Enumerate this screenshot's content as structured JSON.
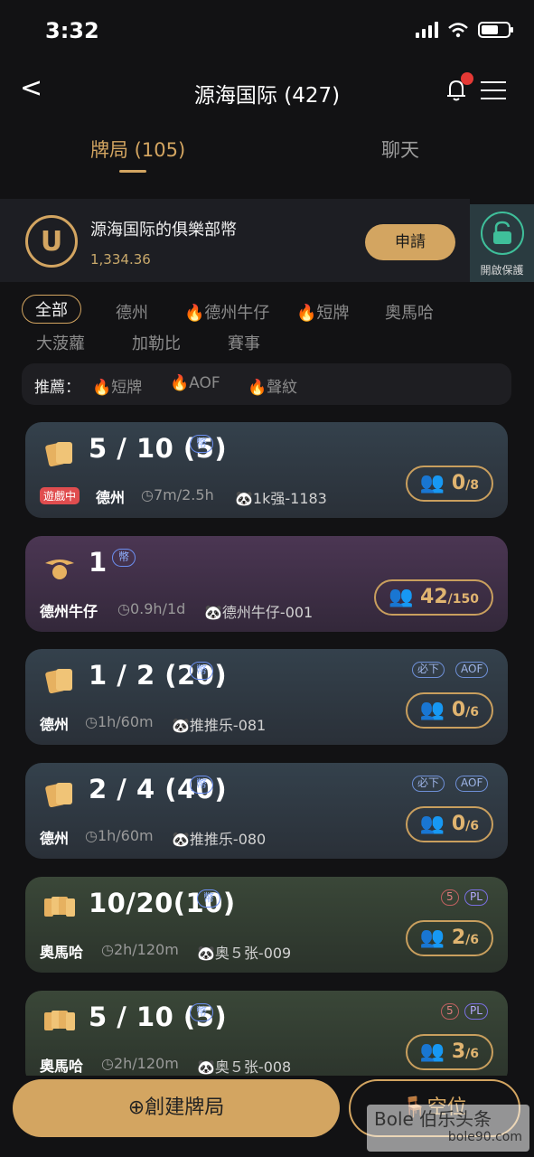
{
  "status": {
    "time": "3:32"
  },
  "nav": {
    "back": "<",
    "title": "源海国际 (427)"
  },
  "tabs": {
    "active": "牌局 (105)",
    "inactive": "聊天"
  },
  "club": {
    "name": "源海国际的俱樂部幣",
    "balance": "1,334.36",
    "apply": "申請",
    "unlock_label": "開啟保護",
    "coin_letter": "U"
  },
  "filters": {
    "all": "全部",
    "f1": "德州",
    "f2": "德州牛仔",
    "f3": "短牌",
    "f4": "奧馬哈",
    "f5": "大菠蘿",
    "f6": "加勒比",
    "f7": "賽事"
  },
  "recommend": {
    "label": "推薦：",
    "r1": "短牌",
    "r2": "AOF",
    "r3": "聲紋"
  },
  "cards": [
    {
      "stakes": "5 / 10 (5)",
      "coin": "幣",
      "status": "遊戲中",
      "game": "德州",
      "time": "7m/2.5h",
      "host": "1k强-1183",
      "seats": "0",
      "max": "/8"
    },
    {
      "stakes": "1",
      "coin": "幣",
      "game": "德州牛仔",
      "time": "0.9h/1d",
      "host": "德州牛仔-001",
      "seats": "42",
      "max": "/150"
    },
    {
      "stakes": "1 / 2 (20)",
      "coin": "幣",
      "tag1": "必下",
      "tag2": "AOF",
      "game": "德州",
      "time": "1h/60m",
      "host": "推推乐-081",
      "seats": "0",
      "max": "/6"
    },
    {
      "stakes": "2 / 4 (40)",
      "coin": "幣",
      "tag1": "必下",
      "tag2": "AOF",
      "game": "德州",
      "time": "1h/60m",
      "host": "推推乐-080",
      "seats": "0",
      "max": "/6"
    },
    {
      "stakes": "10/20(10)",
      "coin": "幣",
      "tag1": "5",
      "tag2": "PL",
      "game": "奧馬哈",
      "time": "2h/120m",
      "host": "奥５张-009",
      "seats": "2",
      "max": "/6"
    },
    {
      "stakes": "5 / 10 (5)",
      "coin": "幣",
      "tag1": "5",
      "tag2": "PL",
      "game": "奧馬哈",
      "time": "2h/120m",
      "host": "奥５张-008",
      "seats": "3",
      "max": "/6"
    }
  ],
  "bottom": {
    "create": "創建牌局",
    "seat": "空位"
  },
  "watermark": {
    "line1": "Bole 伯乐头条",
    "line2": "bole90.com"
  },
  "colors": {
    "accent": "#d3a561",
    "background": "#121214",
    "status_red": "#e04d4f"
  }
}
